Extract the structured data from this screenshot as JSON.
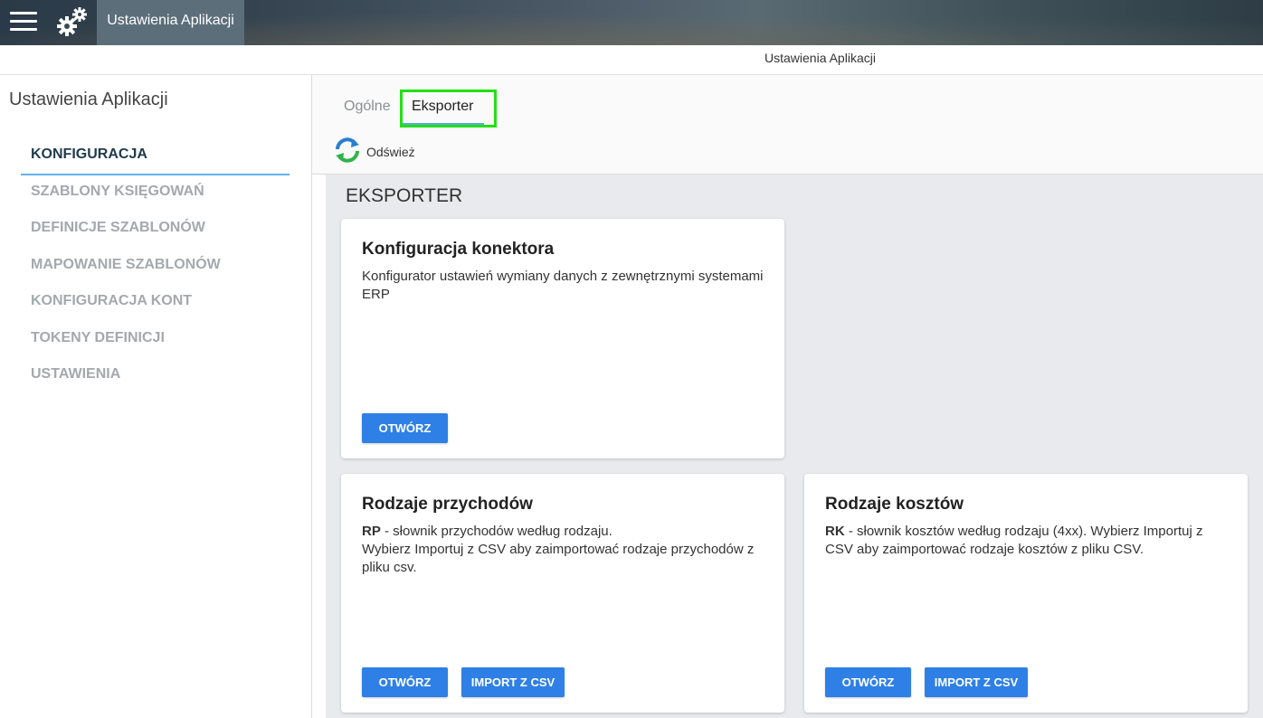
{
  "header": {
    "app_tab_label": "Ustawienia Aplikacji",
    "breadcrumb": "Ustawienia Aplikacji"
  },
  "sidebar": {
    "title": "Ustawienia Aplikacji",
    "items": [
      {
        "label": "KONFIGURACJA",
        "active": true
      },
      {
        "label": "SZABLONY KSIĘGOWAŃ"
      },
      {
        "label": "DEFINICJE SZABLONÓW"
      },
      {
        "label": "MAPOWANIE SZABLONÓW"
      },
      {
        "label": "KONFIGURACJA KONT"
      },
      {
        "label": "TOKENY DEFINICJI"
      },
      {
        "label": "USTAWIENIA"
      }
    ]
  },
  "tabs": {
    "ogolne": "Ogólne",
    "eksporter": "Eksporter",
    "active": "Eksporter"
  },
  "toolbar": {
    "refresh_label": "Odśwież"
  },
  "section": {
    "title": "EKSPORTER"
  },
  "cards": {
    "konektor": {
      "title": "Konfiguracja konektora",
      "desc": "Konfigurator ustawień wymiany danych z zewnętrznymi systemami ERP",
      "open_label": "OTWÓRZ"
    },
    "przychody": {
      "title": "Rodzaje przychodów",
      "code": "RP",
      "desc_line1": " - słownik przychodów według rodzaju.",
      "desc_line2": "Wybierz Importuj z CSV aby zaimportować rodzaje przychodów z pliku csv.",
      "open_label": "OTWÓRZ",
      "import_label": "IMPORT Z CSV"
    },
    "koszty": {
      "title": "Rodzaje kosztów",
      "code": "RK",
      "desc": " - słownik kosztów według rodzaju (4xx). Wybierz Importuj z CSV aby zaimportować rodzaje kosztów z pliku CSV.",
      "open_label": "OTWÓRZ",
      "import_label": "IMPORT Z CSV"
    }
  },
  "colors": {
    "primary_button": "#2f80e6",
    "tab_highlight": "#22e012",
    "active_underline": "#64b1e6"
  }
}
